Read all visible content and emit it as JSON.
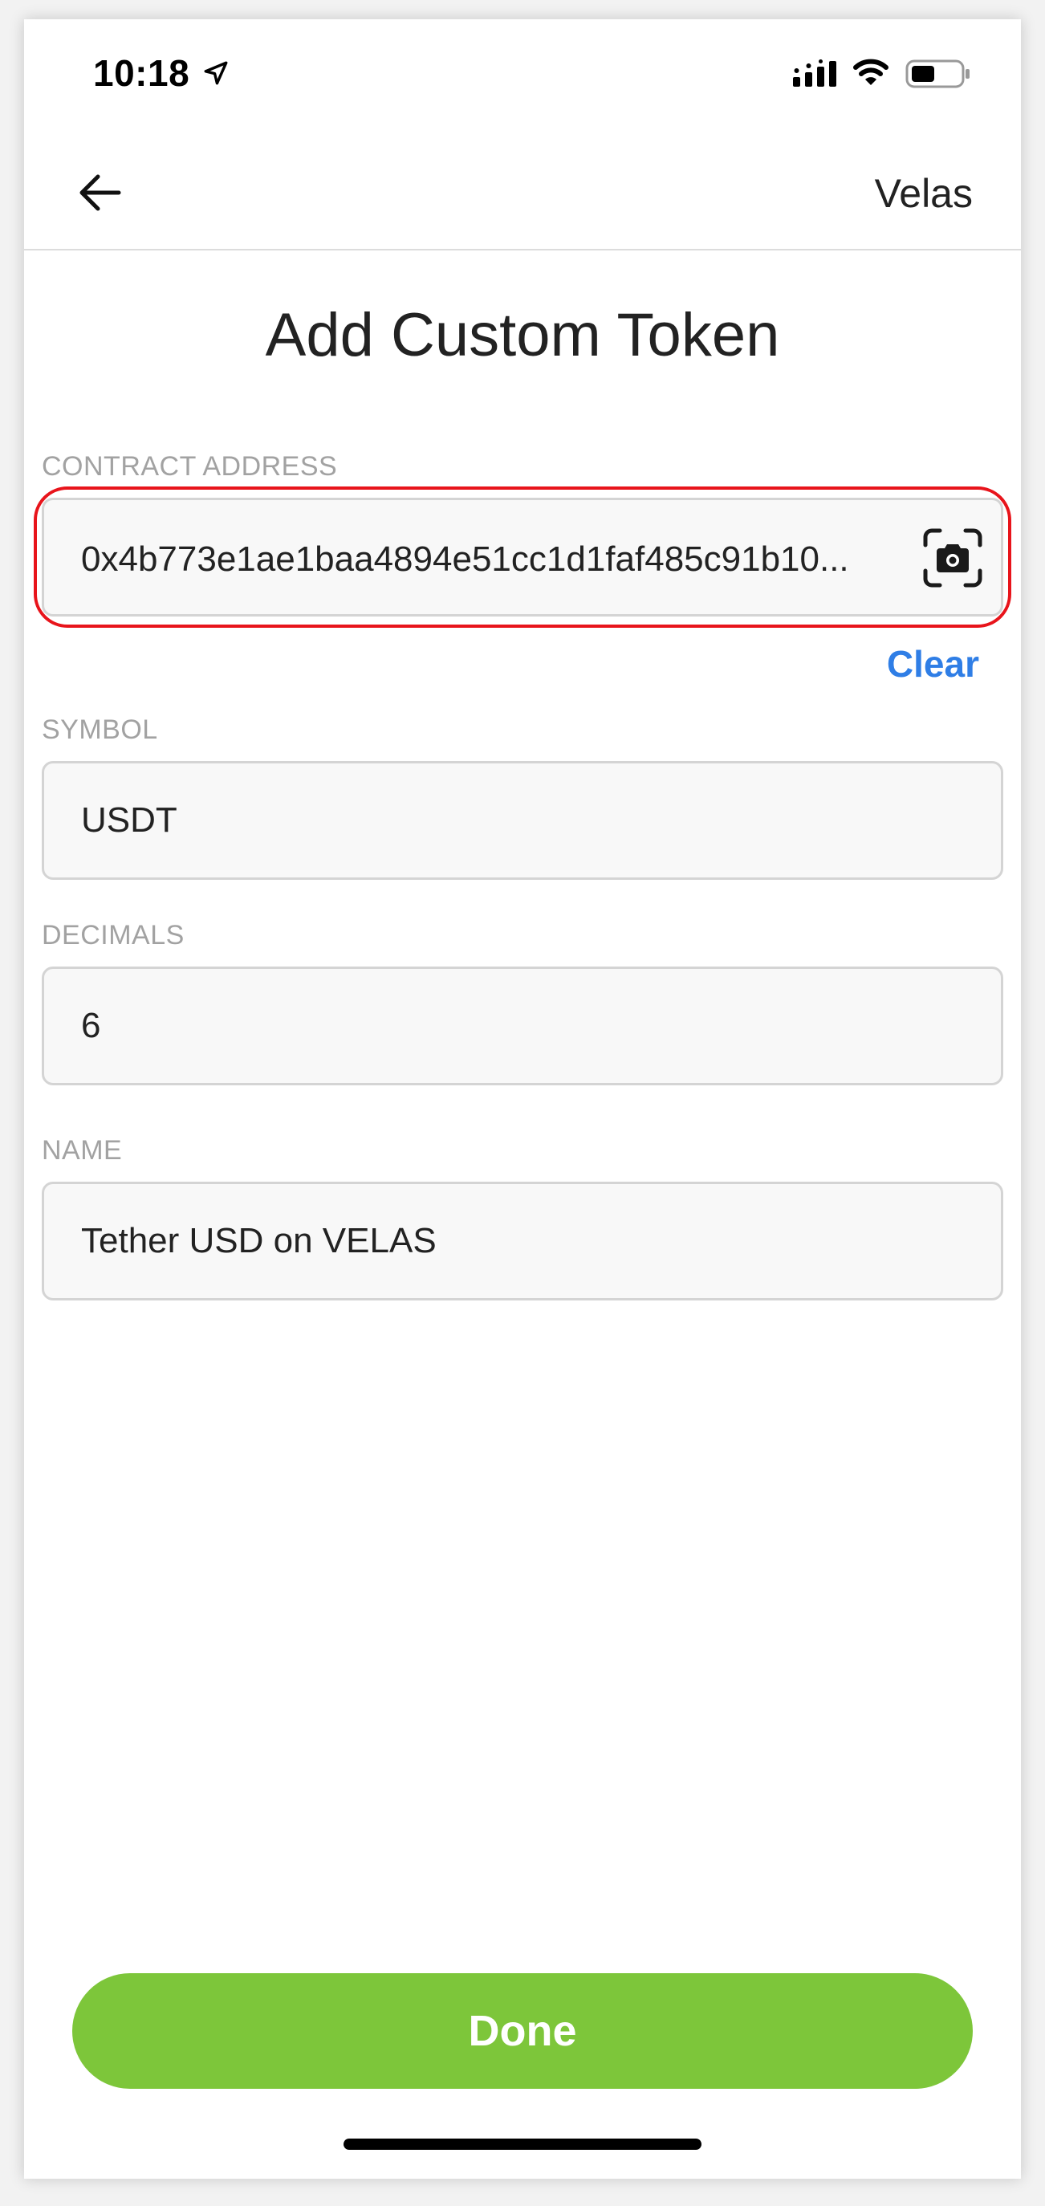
{
  "status_bar": {
    "time": "10:18"
  },
  "header": {
    "back_icon": "arrow-left-icon",
    "network": "Velas"
  },
  "page": {
    "title": "Add Custom Token"
  },
  "form": {
    "contract_address": {
      "label": "CONTRACT ADDRESS",
      "value": "0x4b773e1ae1baa4894e51cc1d1faf485c91b10..."
    },
    "clear_label": "Clear",
    "symbol": {
      "label": "SYMBOL",
      "value": "USDT"
    },
    "decimals": {
      "label": "DECIMALS",
      "value": "6"
    },
    "name": {
      "label": "NAME",
      "value": "Tether USD on VELAS"
    }
  },
  "actions": {
    "done_label": "Done"
  },
  "colors": {
    "accent_green": "#7dc63a",
    "link_blue": "#2f7ee6",
    "highlight_red": "#e8141b"
  }
}
